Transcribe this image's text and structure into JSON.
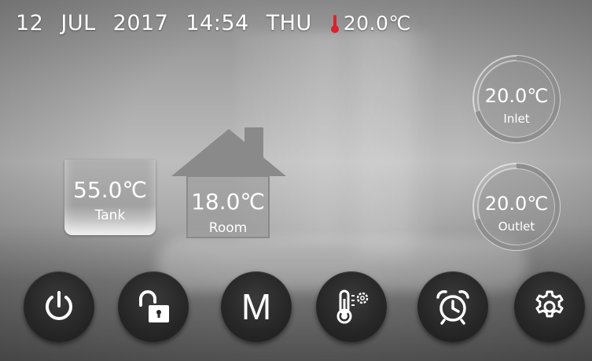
{
  "status_bar": {
    "day": "12",
    "month": "JUL",
    "year": "2017",
    "time": "14:54",
    "weekday": "THU",
    "ambient_temp": "20.0℃",
    "thermometer_icon": "thermometer-icon",
    "thermometer_color": "#e0202a"
  },
  "tank": {
    "value": "55.0℃",
    "label": "Tank"
  },
  "room": {
    "value": "18.0℃",
    "label": "Room"
  },
  "inlet": {
    "value": "20.0℃",
    "label": "Inlet",
    "gauge_fraction": 0.7
  },
  "outlet": {
    "value": "20.0℃",
    "label": "Outlet",
    "gauge_fraction": 0.7
  },
  "buttons": {
    "power": {
      "icon": "power-icon"
    },
    "lock": {
      "icon": "unlock-icon"
    },
    "mode": {
      "label": "M"
    },
    "temp_settings": {
      "icon": "thermometer-gear-icon"
    },
    "timer": {
      "icon": "alarm-clock-icon"
    },
    "settings": {
      "icon": "gear-icon"
    }
  },
  "colors": {
    "accent": "#ffffff",
    "button_bg": "#262626"
  }
}
